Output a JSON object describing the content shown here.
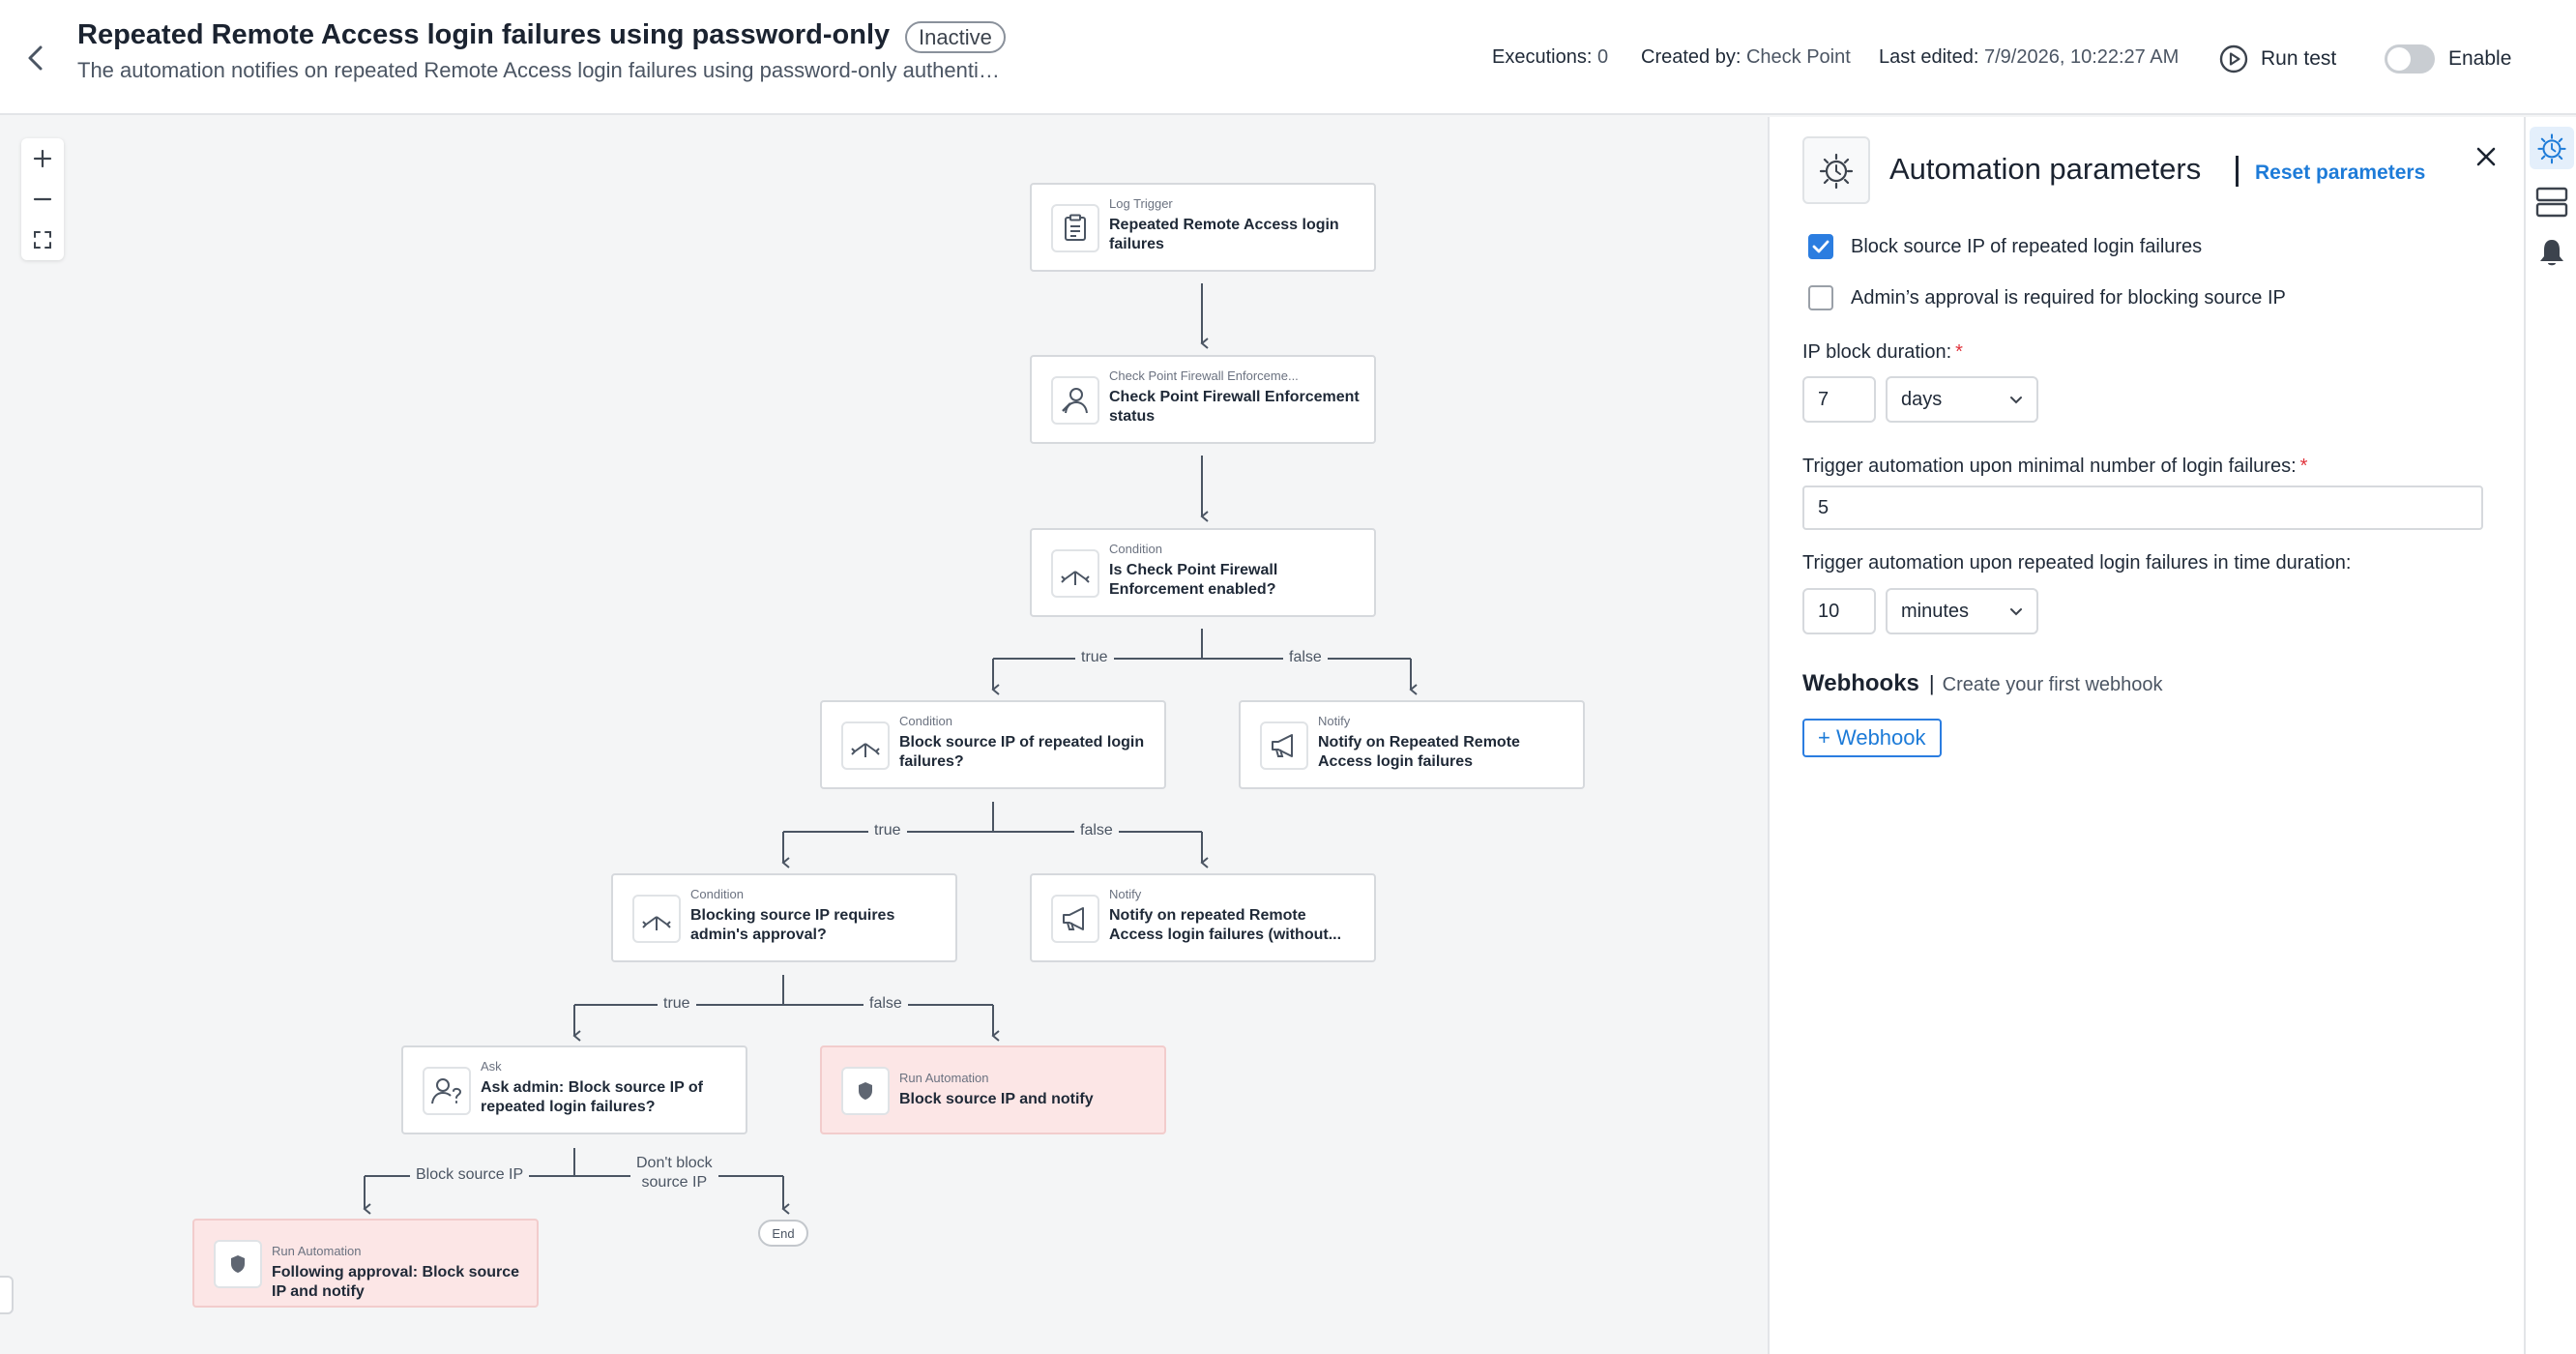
{
  "header": {
    "title": "Repeated Remote Access login failures using password-only",
    "status": "Inactive",
    "subtitle": "The automation notifies on repeated Remote Access login failures using password-only authentic...",
    "executions_label": "Executions:",
    "executions_value": "0",
    "created_label": "Created by:",
    "created_value": "Check Point",
    "edited_label": "Last edited:",
    "edited_value": "7/9/2026, 10:22:27 AM",
    "run_test": "Run test",
    "enable": "Enable",
    "enabled": false
  },
  "flow": {
    "nodes": [
      {
        "type": "Log Trigger",
        "label": "Repeated Remote Access login failures",
        "icon": "clipboard-icon"
      },
      {
        "type": "Check Point Firewall Enforceme...",
        "label": "Check Point Firewall Enforcement status",
        "icon": "firewall-user-icon"
      },
      {
        "type": "Condition",
        "label": "Is Check Point Firewall Enforcement enabled?",
        "icon": "condition-split-icon"
      },
      {
        "type": "Condition",
        "label": "Block source IP of repeated login failures?",
        "icon": "condition-split-icon"
      },
      {
        "type": "Notify",
        "label": "Notify on Repeated Remote Access login failures",
        "icon": "megaphone-icon"
      },
      {
        "type": "Condition",
        "label": "Blocking source IP requires admin's approval?",
        "icon": "condition-split-icon"
      },
      {
        "type": "Notify",
        "label": "Notify on repeated Remote Access login failures (without...",
        "icon": "megaphone-icon"
      },
      {
        "type": "Ask",
        "label": "Ask admin: Block source IP of repeated login failures?",
        "icon": "user-question-icon"
      },
      {
        "type": "Run Automation",
        "label": "Block source IP and notify",
        "icon": "shield-icon"
      },
      {
        "type": "Run Automation",
        "label": "Following approval: Block source IP and notify",
        "icon": "shield-icon"
      }
    ],
    "edge_labels": {
      "true": "true",
      "false": "false",
      "block_source_ip": "Block source IP",
      "dont_block_line1": "Don't block",
      "dont_block_line2": "source IP"
    },
    "end_label": "End"
  },
  "panel": {
    "title": "Automation parameters",
    "reset": "Reset parameters",
    "block_checkbox": {
      "label": "Block source IP of repeated login failures",
      "checked": true
    },
    "approval_checkbox": {
      "label": "Admin’s approval is required for blocking source IP",
      "checked": false
    },
    "ip_block": {
      "label": "IP block duration:",
      "value": "7",
      "unit": "days"
    },
    "min_failures": {
      "label": "Trigger automation upon minimal number of login failures:",
      "value": "5"
    },
    "time_duration": {
      "label": "Trigger automation upon repeated login failures in time duration:",
      "value": "10",
      "unit": "minutes"
    },
    "required_mark": "*",
    "webhooks_title": "Webhooks",
    "webhooks_hint": "Create your first webhook",
    "webhook_button": "+ Webhook"
  },
  "colors": {
    "accent": "#2b7de0",
    "run_automation_bg": "#fce6e6",
    "required": "#e0323b"
  }
}
